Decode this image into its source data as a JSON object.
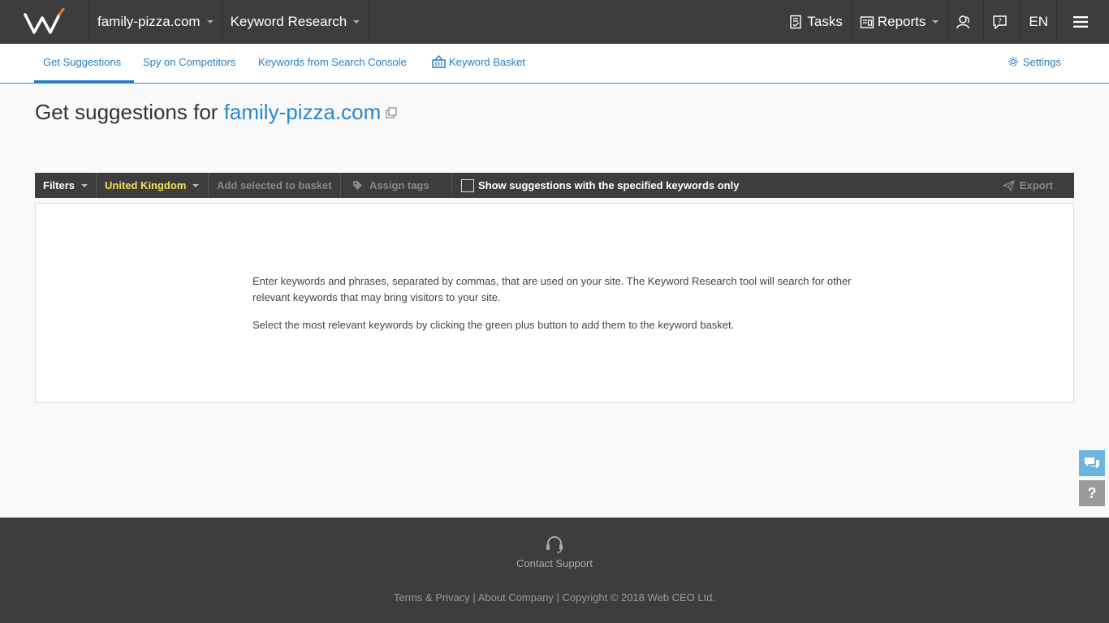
{
  "topbar": {
    "project": "family-pizza.com",
    "module": "Keyword Research",
    "tasks": "Tasks",
    "reports": "Reports",
    "language": "EN"
  },
  "tabs": [
    {
      "label": "Get Suggestions",
      "active": true
    },
    {
      "label": "Spy on Competitors",
      "active": false
    },
    {
      "label": "Keywords from Search Console",
      "active": false
    },
    {
      "label": "Keyword Basket",
      "active": false
    }
  ],
  "settings_label": "Settings",
  "heading": {
    "prefix": "Get suggestions for ",
    "site": "family-pizza.com"
  },
  "toolbar": {
    "filters": "Filters",
    "country": "United Kingdom",
    "add_to_basket": "Add selected to basket",
    "assign_tags": "Assign tags",
    "show_only": "Show suggestions with the specified keywords only",
    "show_only_checked": false,
    "export": "Export"
  },
  "content": {
    "paragraph1": "Enter keywords and phrases, separated by commas, that are used on your site. The Keyword Research tool will search for other relevant keywords that may bring visitors to your site.",
    "paragraph2": "Select the most relevant keywords by clicking the green plus button to add them to the keyword basket."
  },
  "side": {
    "help_label": "?"
  },
  "footer": {
    "contact_support": "Contact Support",
    "terms": "Terms & Privacy",
    "about": "About Company",
    "copyright": "Copyright © 2018 Web CEO Ltd.",
    "separator": " | "
  },
  "colors": {
    "topbar_bg": "#3d3d3d",
    "accent": "#2a7ec3",
    "country_highlight": "#f1e34a",
    "logo_accent": "#f07c1e"
  },
  "icons": {
    "logo": "webceo-logo",
    "tasks": "tasks-icon",
    "reports": "reports-icon",
    "users": "users-icon",
    "help": "help-icon",
    "menu": "hamburger-menu-icon",
    "basket": "basket-icon",
    "settings": "gear-icon",
    "external": "open-external-icon",
    "tag": "tag-icon",
    "export": "paper-plane-icon",
    "chat": "chat-icon",
    "support": "headset-icon"
  }
}
